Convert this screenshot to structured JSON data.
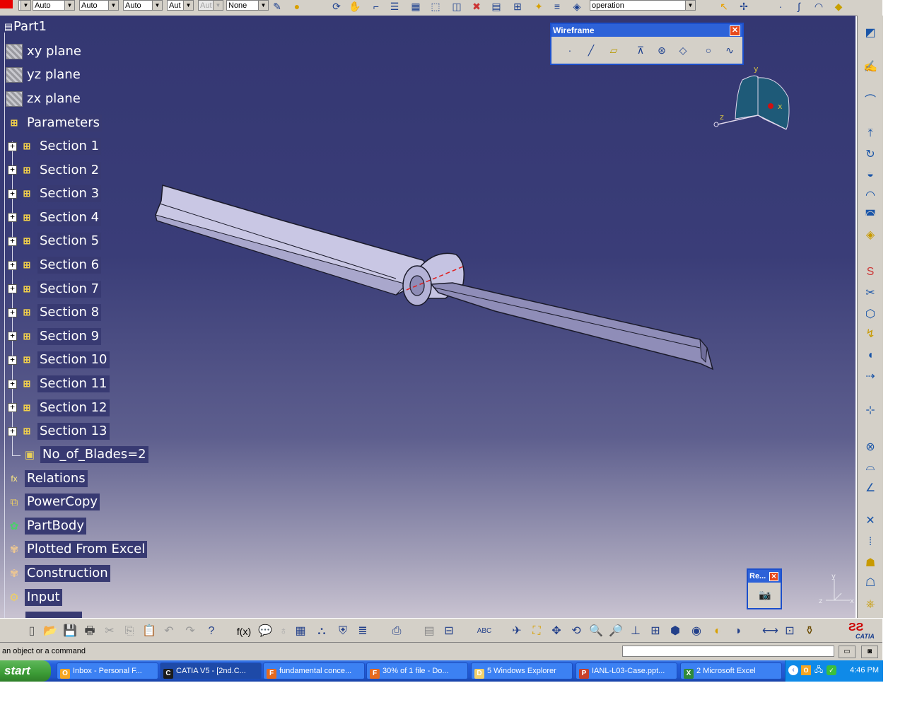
{
  "top_toolbar": {
    "combos": [
      "Auto",
      "Auto",
      "Auto",
      "Aut",
      "Aut",
      "None",
      "operation"
    ],
    "disabled_combo_index": 4
  },
  "tree": {
    "root": "Part1",
    "planes": [
      "xy plane",
      "yz plane",
      "zx plane"
    ],
    "parameters_label": "Parameters",
    "sections": [
      "Section 1",
      "Section 2",
      "Section 3",
      "Section 4",
      "Section 5",
      "Section 6",
      "Section 7",
      "Section 8",
      "Section 9",
      "Section 10",
      "Section 11",
      "Section 12",
      "Section 13"
    ],
    "param_value": "No_of_Blades=2",
    "nodes": [
      "Relations",
      "PowerCopy",
      "PartBody",
      "Plotted From Excel",
      "Construction",
      "Input"
    ]
  },
  "wireframe_panel": {
    "title": "Wireframe",
    "icons": [
      "point-icon",
      "line-icon",
      "plane-icon",
      "projection-icon",
      "intersection-icon",
      "parallel-curve-icon",
      "circle-icon",
      "spline-icon"
    ]
  },
  "compass": {
    "y_label": "y",
    "x_label": "x",
    "z_label": "z"
  },
  "record_panel": {
    "title": "Re..."
  },
  "axis_triad": {
    "y_label": "y",
    "z_label": "z",
    "x_label": "x"
  },
  "status_bar": {
    "text": "an object or a command"
  },
  "taskbar": {
    "start_label": "start",
    "tasks": [
      {
        "label": "Inbox - Personal F...",
        "icon": "O",
        "icon_color": "#f5a623"
      },
      {
        "label": "CATIA V5 - [2nd.C...",
        "icon": "C",
        "icon_color": "#1b1b1b"
      },
      {
        "label": "fundamental conce...",
        "icon": "F",
        "icon_color": "#e66a1f"
      },
      {
        "label": "30% of 1 file - Do...",
        "icon": "F",
        "icon_color": "#e66a1f"
      },
      {
        "label": "5 Windows Explorer",
        "icon": "D",
        "icon_color": "#f3d16a"
      },
      {
        "label": "IANL-L03-Case.ppt...",
        "icon": "P",
        "icon_color": "#c8412a"
      },
      {
        "label": "2 Microsoft Excel",
        "icon": "X",
        "icon_color": "#2f8a3a"
      }
    ],
    "clock": "4:46 PM"
  },
  "catia_logo": "CATIA",
  "colors": {
    "viewport_top": "#343772",
    "tree_label_bg": "#383a72",
    "blade": "#cfcde8",
    "xp_blue": "#245edb"
  }
}
